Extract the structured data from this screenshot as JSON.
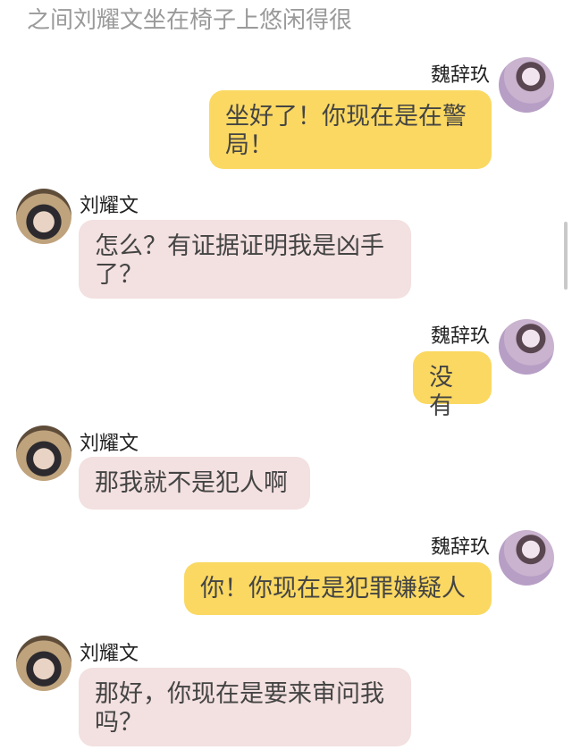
{
  "narration": "之间刘耀文坐在椅子上悠闲得很",
  "messages": [
    {
      "side": "right",
      "speaker": "魏辞玖",
      "text": "坐好了！你现在是在警局！"
    },
    {
      "side": "left",
      "speaker": "刘耀文",
      "text": "怎么？有证据证明我是凶手了？"
    },
    {
      "side": "right",
      "speaker": "魏辞玖",
      "text": "没有"
    },
    {
      "side": "left",
      "speaker": "刘耀文",
      "text": "那我就不是犯人啊"
    },
    {
      "side": "right",
      "speaker": "魏辞玖",
      "text": "你！你现在是犯罪嫌疑人"
    },
    {
      "side": "left",
      "speaker": "刘耀文",
      "text": "那好，你现在是要来审问我吗？"
    }
  ]
}
